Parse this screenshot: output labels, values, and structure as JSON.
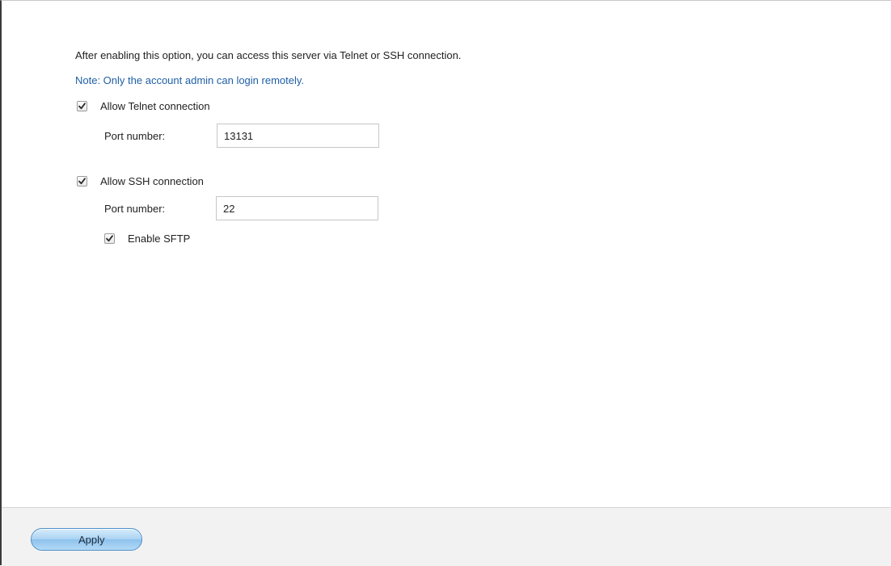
{
  "description": "After enabling this option, you can access this server via Telnet or SSH connection.",
  "note": "Note: Only the account admin can login remotely.",
  "telnet": {
    "label": "Allow Telnet connection",
    "checked": true,
    "port_label": "Port number:",
    "port_value": "13131"
  },
  "ssh": {
    "label": "Allow SSH connection",
    "checked": true,
    "port_label": "Port number:",
    "port_value": "22",
    "sftp": {
      "label": "Enable SFTP",
      "checked": true
    }
  },
  "footer": {
    "apply_label": "Apply"
  },
  "colors": {
    "note": "#1f5fa6",
    "apply_button": "#a9d2f3",
    "footer_bg": "#f2f2f2"
  },
  "icons": {
    "checkbox": "checkmark-icon"
  }
}
